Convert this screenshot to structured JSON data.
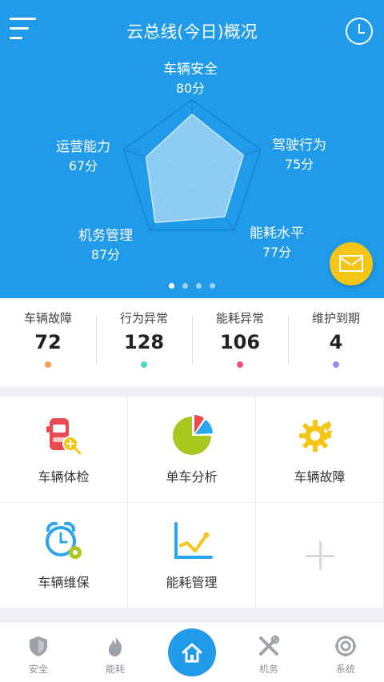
{
  "header": {
    "title": "云总线(今日)概况",
    "menu_icon": "menu-icon",
    "clock_icon": "clock-icon",
    "mail_icon": "mail-icon"
  },
  "radar": {
    "axes": [
      {
        "label": "车辆安全",
        "value": 80,
        "value_text": "80分"
      },
      {
        "label": "驾驶行为",
        "value": 75,
        "value_text": "75分"
      },
      {
        "label": "能耗水平",
        "value": 77,
        "value_text": "77分"
      },
      {
        "label": "机务管理",
        "value": 87,
        "value_text": "87分"
      },
      {
        "label": "运营能力",
        "value": 67,
        "value_text": "67分"
      }
    ],
    "max": 100,
    "pages": 4,
    "active_page": 1
  },
  "stats": [
    {
      "label": "车辆故障",
      "value": "72",
      "dot_color": "#f5a04a"
    },
    {
      "label": "行为异常",
      "value": "128",
      "dot_color": "#4fd3c4"
    },
    {
      "label": "能耗异常",
      "value": "106",
      "dot_color": "#f0527a"
    },
    {
      "label": "维护到期",
      "value": "4",
      "dot_color": "#9a8cf0"
    }
  ],
  "grid": [
    {
      "label": "车辆体检",
      "icon": "car-checkup-icon"
    },
    {
      "label": "单车分析",
      "icon": "pie-chart-icon"
    },
    {
      "label": "车辆故障",
      "icon": "gear-wrench-icon"
    },
    {
      "label": "车辆维保",
      "icon": "alarm-clock-icon"
    },
    {
      "label": "能耗管理",
      "icon": "line-chart-icon"
    },
    {
      "label": "",
      "icon": "plus-icon"
    }
  ],
  "tabs": [
    {
      "label": "安全",
      "icon": "shield-icon"
    },
    {
      "label": "能耗",
      "icon": "flame-icon"
    },
    {
      "label": "",
      "icon": "home-icon"
    },
    {
      "label": "机务",
      "icon": "tools-icon"
    },
    {
      "label": "系统",
      "icon": "settings-icon"
    }
  ],
  "colors": {
    "primary": "#1f9bea",
    "accent_yellow": "#f4c515",
    "icon_red": "#e84a4f",
    "icon_yellow": "#f5c518",
    "icon_green": "#a8c81e",
    "icon_blue": "#2aa6ee"
  }
}
